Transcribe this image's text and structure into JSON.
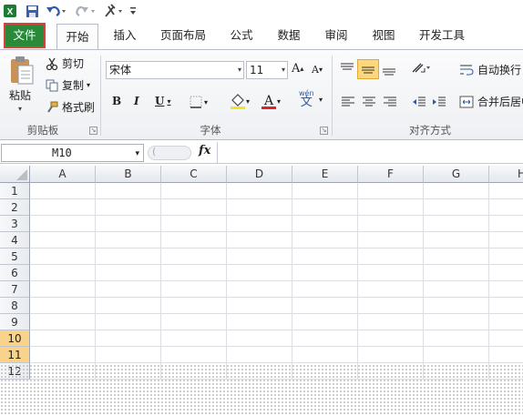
{
  "quick_access": {
    "icons": [
      "excel-logo-icon",
      "save-icon",
      "undo-icon",
      "redo-icon",
      "tools-icon",
      "customize-icon"
    ]
  },
  "tabs": {
    "file": "文件",
    "home": "开始",
    "insert": "插入",
    "page_layout": "页面布局",
    "formulas": "公式",
    "data": "数据",
    "review": "审阅",
    "view": "视图",
    "developer": "开发工具"
  },
  "clipboard": {
    "paste": "粘贴",
    "cut": "剪切",
    "copy": "复制",
    "format_painter": "格式刷",
    "group_label": "剪贴板"
  },
  "font": {
    "name": "宋体",
    "size": "11",
    "bold": "B",
    "italic": "I",
    "underline": "U",
    "font_color_letter": "A",
    "phonetic": "wén",
    "phonetic_char": "文",
    "group_label": "字体",
    "highlight_color": "#f5e320",
    "font_color": "#e0202a"
  },
  "alignment": {
    "wrap_text": "自动换行",
    "merge_center": "合并后居中",
    "group_label": "对齐方式"
  },
  "formula_bar": {
    "name_box": "M10",
    "fx": "fx",
    "formula": ""
  },
  "sheet": {
    "columns": [
      "A",
      "B",
      "C",
      "D",
      "E",
      "F",
      "G",
      "H"
    ],
    "rows": [
      "1",
      "2",
      "3",
      "4",
      "5",
      "6",
      "7",
      "8",
      "9",
      "10",
      "11",
      "12"
    ],
    "selected_rows": [
      "10",
      "11"
    ]
  },
  "colors": {
    "file_tab": "#2a8a3a",
    "file_tab_highlight": "#d8423a",
    "selected_row_header": "#f9d38a"
  }
}
